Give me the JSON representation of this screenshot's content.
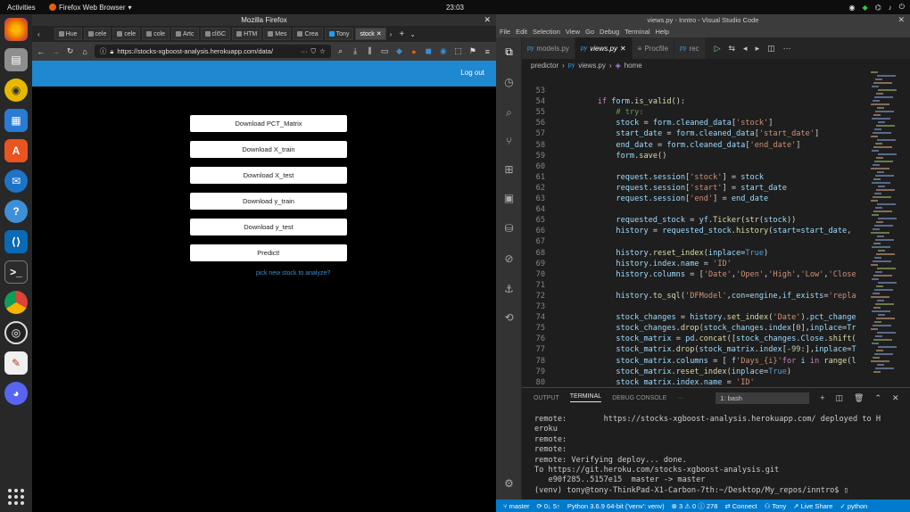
{
  "topbar": {
    "activities": "Activities",
    "app_name": "Firefox Web Browser",
    "clock": "23:03"
  },
  "firefox": {
    "window_title": "Mozilla Firefox",
    "tabs": [
      "Hue",
      "cele",
      "cele",
      "cole",
      "Artc",
      "cli5C",
      "HTM",
      "Mes",
      "Crea",
      "Tony",
      "stock"
    ],
    "url": "https://stocks-xgboost-analysis.herokuapp.com/data/",
    "url_more": "···",
    "header": {
      "logout": "Log out"
    },
    "buttons": [
      "Download PCT_Matrix",
      "Download X_train",
      "Download X_test",
      "Download y_train",
      "Download y_test",
      "Predict!"
    ],
    "pick_link": "pick new stock to analyze?"
  },
  "vscode": {
    "window_title": "views.py - Inntro - Visual Studio Code",
    "menu": [
      "File",
      "Edit",
      "Selection",
      "View",
      "Go",
      "Debug",
      "Terminal",
      "Help"
    ],
    "tabs": [
      {
        "label": "models.py"
      },
      {
        "label": "views.py"
      },
      {
        "label": "Procfile"
      },
      {
        "label": "rec"
      }
    ],
    "breadcrumb": [
      "predictor",
      "views.py",
      "home"
    ],
    "code_lines": [
      {
        "n": "53",
        "t": ""
      },
      {
        "n": "54",
        "t": "    if form.is_valid():"
      },
      {
        "n": "55",
        "t": "        # try:"
      },
      {
        "n": "56",
        "t": "        stock = form.cleaned_data['stock']"
      },
      {
        "n": "57",
        "t": "        start_date = form.cleaned_data['start_date']"
      },
      {
        "n": "58",
        "t": "        end_date = form.cleaned_data['end_date']"
      },
      {
        "n": "59",
        "t": "        form.save()"
      },
      {
        "n": "60",
        "t": ""
      },
      {
        "n": "61",
        "t": "        request.session['stock'] = stock"
      },
      {
        "n": "62",
        "t": "        request.session['start'] = start_date"
      },
      {
        "n": "63",
        "t": "        request.session['end'] = end_date"
      },
      {
        "n": "64",
        "t": ""
      },
      {
        "n": "65",
        "t": "        requested_stock = yf.Ticker(str(stock))"
      },
      {
        "n": "66",
        "t": "        history = requested_stock.history(start=start_date,"
      },
      {
        "n": "67",
        "t": ""
      },
      {
        "n": "68",
        "t": "        history.reset_index(inplace=True)"
      },
      {
        "n": "69",
        "t": "        history.index.name = 'ID'"
      },
      {
        "n": "70",
        "t": "        history.columns = ['Date','Open','High','Low','Close"
      },
      {
        "n": "71",
        "t": ""
      },
      {
        "n": "72",
        "t": "        history.to_sql('DFModel',con=engine,if_exists='repla"
      },
      {
        "n": "73",
        "t": ""
      },
      {
        "n": "74",
        "t": "        stock_changes = history.set_index('Date').pct_change"
      },
      {
        "n": "75",
        "t": "        stock_changes.drop(stock_changes.index[0],inplace=Tr"
      },
      {
        "n": "76",
        "t": "        stock_matrix = pd.concat([stock_changes.Close.shift("
      },
      {
        "n": "77",
        "t": "        stock_matrix.drop(stock_matrix.index[-99:],inplace=T"
      },
      {
        "n": "78",
        "t": "        stock_matrix.columns = [ f'Days_{i}'for i in range(l"
      },
      {
        "n": "79",
        "t": "        stock_matrix.reset_index(inplace=True)"
      },
      {
        "n": "80",
        "t": "        stock_matrix.index.name = 'ID'"
      },
      {
        "n": "81",
        "t": ""
      }
    ],
    "panel": {
      "tabs": [
        "OUTPUT",
        "TERMINAL",
        "DEBUG CONSOLE",
        "···"
      ],
      "terminal_select": "1: bash"
    },
    "terminal": [
      "remote:        https://stocks-xgboost-analysis.herokuapp.com/ deployed to H",
      "eroku",
      "remote:",
      "remote:",
      "remote: Verifying deploy... done.",
      "To https://git.heroku.com/stocks-xgboost-analysis.git",
      "   e90f285..5157e15  master -> master",
      "(venv) tony@tony-ThinkPad-X1-Carbon-7th:~/Desktop/My_repos/inntro$ ▯"
    ],
    "status": [
      "master",
      "0↓ 5↑",
      "Python 3.6.9 64-bit ('venv': venv)",
      "⊗ 3 ⚠ 0 ⓘ 278",
      "Connect",
      "Tony",
      "Live Share",
      "python"
    ]
  }
}
